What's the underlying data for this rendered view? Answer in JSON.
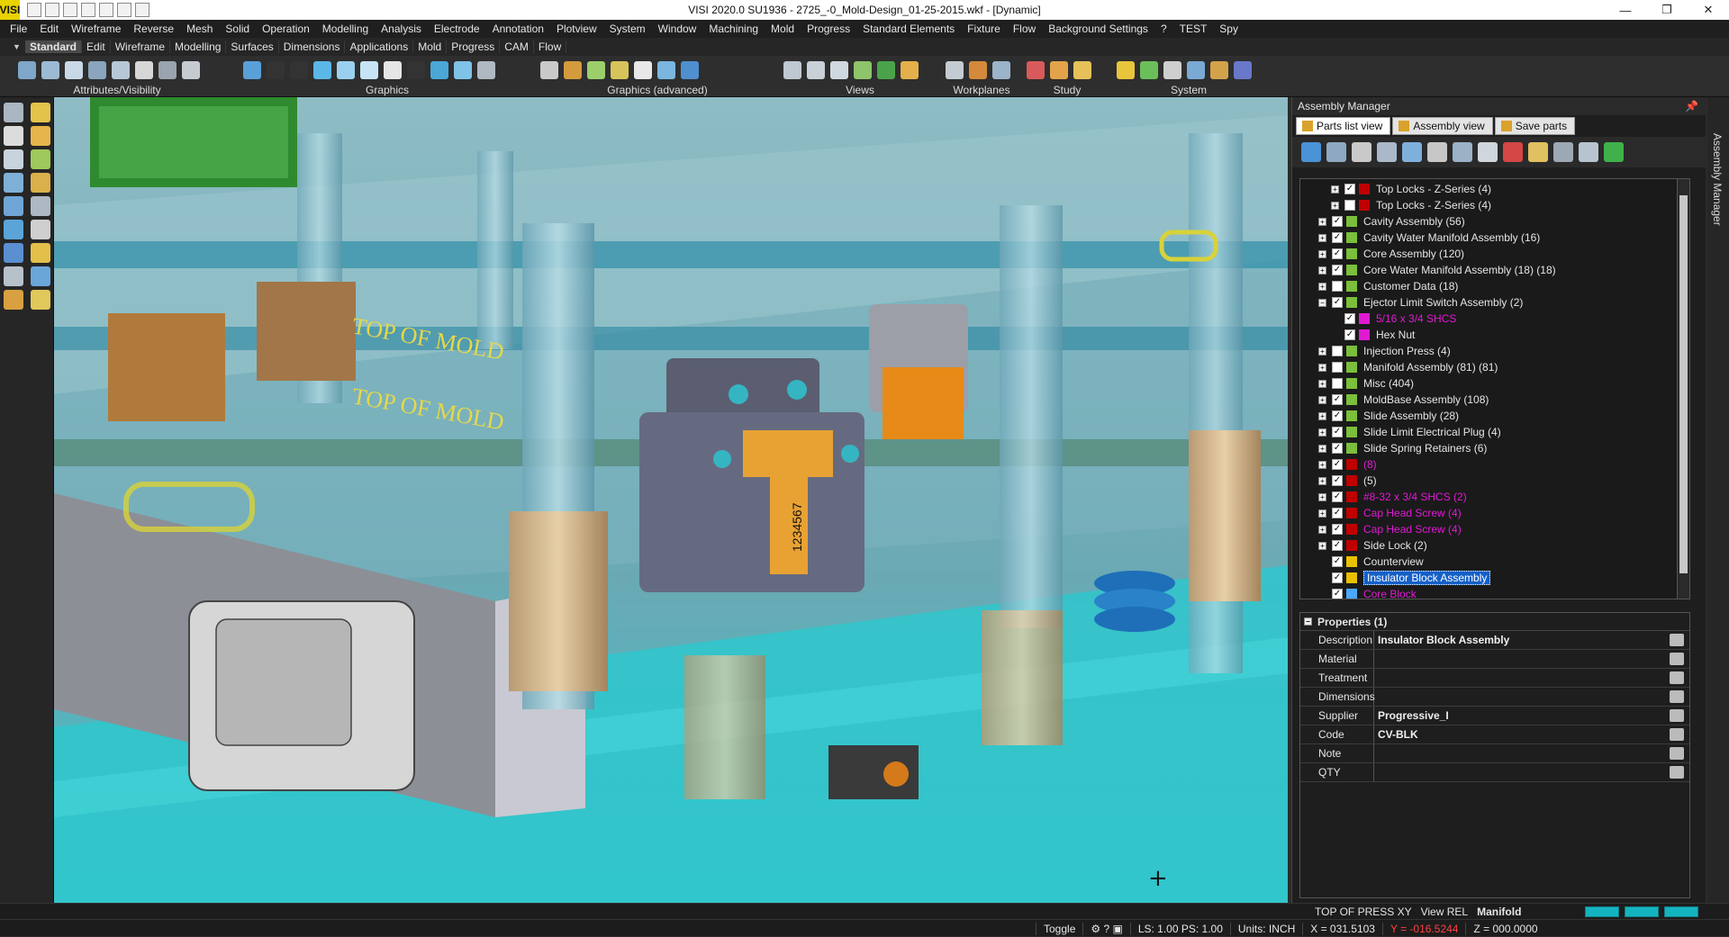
{
  "window": {
    "title": "VISI 2020.0 SU1936 - 2725_-0_Mold-Design_01-25-2015.wkf - [Dynamic]",
    "logo_text": "VISI",
    "controls": [
      "—",
      "❐",
      "✕"
    ]
  },
  "menu": [
    "File",
    "Edit",
    "Wireframe",
    "Reverse",
    "Mesh",
    "Solid",
    "Operation",
    "Modelling",
    "Analysis",
    "Electrode",
    "Annotation",
    "Plotview",
    "System",
    "Window",
    "Machining",
    "Mold",
    "Progress",
    "Standard Elements",
    "Fixture",
    "Flow",
    "Background Settings",
    "?",
    "TEST",
    "Spy"
  ],
  "ribbon_tabs": [
    "Standard",
    "Edit",
    "Wireframe",
    "Modelling",
    "Surfaces",
    "Dimensions",
    "Applications",
    "Mold",
    "Progress",
    "CAM",
    "Flow"
  ],
  "active_ribbon_tab": "Standard",
  "ribbon_groups": [
    "Attributes/Visibility",
    "Graphics",
    "Graphics (advanced)",
    "Views",
    "Workplanes",
    "Study",
    "System"
  ],
  "viewport": {
    "labels": [
      "TOP OF MOLD",
      "TOP OF MOLD"
    ],
    "part_number": "1234567",
    "cursor": "+"
  },
  "assembly_manager": {
    "title": "Assembly Manager",
    "pin_icon": "pin-icon",
    "tabs": [
      "Parts list view",
      "Assembly view",
      "Save parts"
    ],
    "tree": [
      {
        "indent": 2,
        "expander": "+",
        "checked": true,
        "icon_color": "#c00000",
        "label": "Top Locks - Z-Series (4)",
        "style": "normal"
      },
      {
        "indent": 2,
        "expander": "+",
        "checked": false,
        "icon_color": "#c00000",
        "label": "Top Locks - Z-Series (4)",
        "style": "normal"
      },
      {
        "indent": 1,
        "expander": "+",
        "checked": true,
        "icon_color": "#7bbf3a",
        "label": "Cavity Assembly (56)",
        "style": "normal"
      },
      {
        "indent": 1,
        "expander": "+",
        "checked": true,
        "icon_color": "#7bbf3a",
        "label": "Cavity Water Manifold Assembly (16)",
        "style": "normal"
      },
      {
        "indent": 1,
        "expander": "+",
        "checked": true,
        "icon_color": "#7bbf3a",
        "label": "Core Assembly (120)",
        "style": "normal"
      },
      {
        "indent": 1,
        "expander": "+",
        "checked": true,
        "icon_color": "#7bbf3a",
        "label": "Core Water Manifold Assembly (18) (18)",
        "style": "normal"
      },
      {
        "indent": 1,
        "expander": "+",
        "checked": false,
        "icon_color": "#7bbf3a",
        "label": "Customer Data (18)",
        "style": "normal"
      },
      {
        "indent": 1,
        "expander": "−",
        "checked": true,
        "icon_color": "#7bbf3a",
        "label": "Ejector Limit Switch Assembly (2)",
        "style": "normal"
      },
      {
        "indent": 2,
        "expander": "",
        "checked": true,
        "icon_color": "#e01ad3",
        "label": "5/16 x 3/4 SHCS",
        "style": "mag"
      },
      {
        "indent": 2,
        "expander": "",
        "checked": true,
        "icon_color": "#e01ad3",
        "label": "Hex Nut",
        "style": "normal"
      },
      {
        "indent": 1,
        "expander": "+",
        "checked": false,
        "icon_color": "#7bbf3a",
        "label": "Injection Press (4)",
        "style": "normal"
      },
      {
        "indent": 1,
        "expander": "+",
        "checked": false,
        "icon_color": "#7bbf3a",
        "label": "Manifold Assembly (81) (81)",
        "style": "normal"
      },
      {
        "indent": 1,
        "expander": "+",
        "checked": false,
        "icon_color": "#7bbf3a",
        "label": "Misc (404)",
        "style": "normal"
      },
      {
        "indent": 1,
        "expander": "+",
        "checked": true,
        "icon_color": "#7bbf3a",
        "label": "MoldBase Assembly (108)",
        "style": "normal"
      },
      {
        "indent": 1,
        "expander": "+",
        "checked": true,
        "icon_color": "#7bbf3a",
        "label": "Slide Assembly (28)",
        "style": "normal"
      },
      {
        "indent": 1,
        "expander": "+",
        "checked": true,
        "icon_color": "#7bbf3a",
        "label": "Slide Limit Electrical Plug (4)",
        "style": "normal"
      },
      {
        "indent": 1,
        "expander": "+",
        "checked": true,
        "icon_color": "#7bbf3a",
        "label": "Slide Spring Retainers (6)",
        "style": "normal"
      },
      {
        "indent": 1,
        "expander": "+",
        "checked": true,
        "icon_color": "#c00000",
        "label": "(8)",
        "style": "mag"
      },
      {
        "indent": 1,
        "expander": "+",
        "checked": true,
        "icon_color": "#c00000",
        "label": "(5)",
        "style": "normal"
      },
      {
        "indent": 1,
        "expander": "+",
        "checked": true,
        "icon_color": "#c00000",
        "label": "#8-32 x 3/4 SHCS (2)",
        "style": "mag"
      },
      {
        "indent": 1,
        "expander": "+",
        "checked": true,
        "icon_color": "#c00000",
        "label": "Cap Head Screw (4)",
        "style": "mag"
      },
      {
        "indent": 1,
        "expander": "+",
        "checked": true,
        "icon_color": "#c00000",
        "label": "Cap Head Screw (4)",
        "style": "mag"
      },
      {
        "indent": 1,
        "expander": "+",
        "checked": true,
        "icon_color": "#c00000",
        "label": "Side Lock (2)",
        "style": "normal"
      },
      {
        "indent": 1,
        "expander": "",
        "checked": true,
        "icon_color": "#e8c000",
        "label": "Counterview",
        "style": "normal"
      },
      {
        "indent": 1,
        "expander": "",
        "checked": true,
        "icon_color": "#e8c000",
        "label": "Insulator Block Assembly",
        "style": "sel"
      },
      {
        "indent": 1,
        "expander": "",
        "checked": true,
        "icon_color": "#4aa8ff",
        "label": "Core Block",
        "style": "mag"
      }
    ]
  },
  "properties": {
    "header": "Properties (1)",
    "rows": [
      {
        "key": "Description",
        "value": "Insulator Block Assembly"
      },
      {
        "key": "Material",
        "value": ""
      },
      {
        "key": "Treatment",
        "value": ""
      },
      {
        "key": "Dimensions",
        "value": ""
      },
      {
        "key": "Supplier",
        "value": "Progressive_I"
      },
      {
        "key": "Code",
        "value": "CV-BLK"
      },
      {
        "key": "Note",
        "value": ""
      },
      {
        "key": "QTY",
        "value": ""
      }
    ]
  },
  "side_strip_label": "Assembly Manager",
  "status_bar": {
    "workplane": "TOP OF PRESS XY",
    "view_mode": "View REL",
    "layer": "Manifold",
    "toggle": "Toggle",
    "ls_ps": "LS: 1.00 PS: 1.00",
    "units": "Units: INCH",
    "x": "X = 031.5103",
    "y": "Y = -016.5244",
    "z": "Z = 000.0000"
  }
}
